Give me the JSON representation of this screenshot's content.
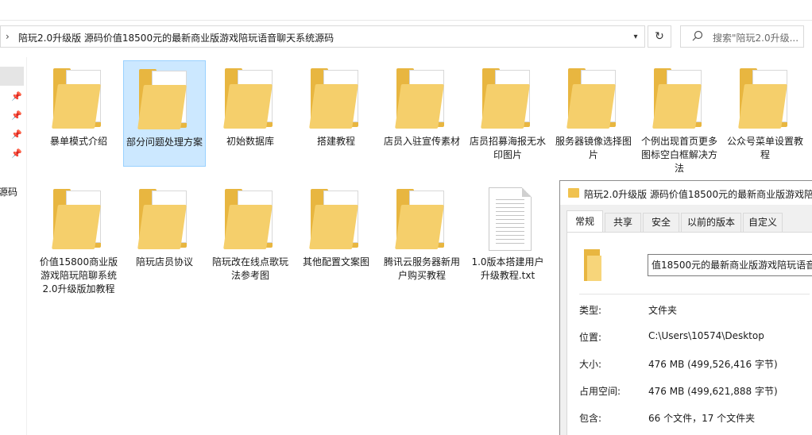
{
  "address": {
    "path": "陪玩2.0升级版 源码价值18500元的最新商业版游戏陪玩语音聊天系统源码",
    "search_placeholder": "搜索\"陪玩2.0升级..."
  },
  "nav": {
    "partial_label": "源码"
  },
  "items": [
    {
      "label": "暴单模式介绍",
      "kind": "folder"
    },
    {
      "label": "部分问题处理方案",
      "kind": "folder",
      "selected": true
    },
    {
      "label": "初始数据库",
      "kind": "folder"
    },
    {
      "label": "搭建教程",
      "kind": "folder"
    },
    {
      "label": "店员入驻宣传素材",
      "kind": "folder"
    },
    {
      "label": "店员招募海报无水印图片",
      "kind": "folder"
    },
    {
      "label": "服务器镜像选择图片",
      "kind": "folder"
    },
    {
      "label": "个例出现首页更多图标空白框解决方法",
      "kind": "folder"
    },
    {
      "label": "公众号菜单设置教程",
      "kind": "folder"
    },
    {
      "label": "价值15800商业版游戏陪玩陪聊系统2.0升级版加教程",
      "kind": "folder"
    },
    {
      "label": "陪玩店员协议",
      "kind": "folder"
    },
    {
      "label": "陪玩改在线点歌玩法参考图",
      "kind": "folder"
    },
    {
      "label": "其他配置文案图",
      "kind": "folder"
    },
    {
      "label": "腾讯云服务器新用户购买教程",
      "kind": "folder"
    },
    {
      "label": "1.0版本搭建用户升级教程.txt",
      "kind": "txt"
    }
  ],
  "properties": {
    "title": "陪玩2.0升级版 源码价值18500元的最新商业版游戏陪玩语",
    "tabs": [
      "常规",
      "共享",
      "安全",
      "以前的版本",
      "自定义"
    ],
    "name_value": "值18500元的最新商业版游戏陪玩语音",
    "rows": [
      {
        "label": "类型:",
        "value": "文件夹"
      },
      {
        "label": "位置:",
        "value": "C:\\Users\\10574\\Desktop"
      },
      {
        "label": "大小:",
        "value": "476 MB (499,526,416 字节)"
      },
      {
        "label": "占用空间:",
        "value": "476 MB (499,621,888 字节)"
      },
      {
        "label": "包含:",
        "value": "66 个文件，17 个文件夹"
      }
    ]
  }
}
